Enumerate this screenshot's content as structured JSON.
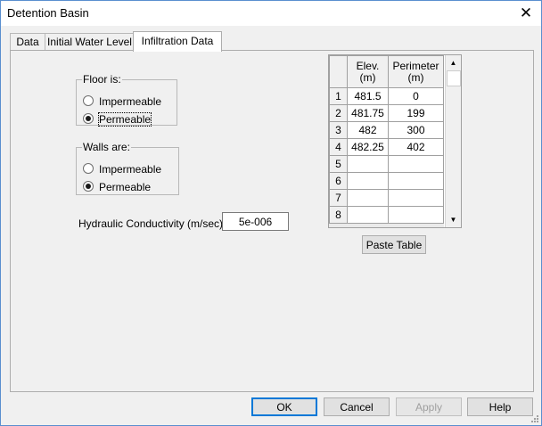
{
  "window": {
    "title": "Detention Basin"
  },
  "icons": {
    "close": "close-icon",
    "scroll_up": "scroll-up-arrow-icon",
    "scroll_down": "scroll-down-arrow-icon",
    "resize": "resize-grip-icon"
  },
  "tabs": [
    {
      "label": "Data"
    },
    {
      "label": "Initial Water Level"
    },
    {
      "label": "Infiltration Data"
    }
  ],
  "floor": {
    "legend": "Floor is:",
    "options": [
      {
        "label": "Impermeable",
        "checked": false
      },
      {
        "label": "Permeable",
        "checked": true
      }
    ]
  },
  "walls": {
    "legend": "Walls are:",
    "options": [
      {
        "label": "Impermeable",
        "checked": false
      },
      {
        "label": "Permeable",
        "checked": true
      }
    ]
  },
  "conductivity": {
    "label": "Hydraulic Conductivity (m/sec)",
    "value": "5e-006"
  },
  "table": {
    "headers": {
      "elev_line1": "Elev.",
      "elev_line2": "(m)",
      "perim_line1": "Perimeter",
      "perim_line2": "(m)"
    },
    "rows": [
      {
        "num": "1",
        "elev": "481.5",
        "perim": "0"
      },
      {
        "num": "2",
        "elev": "481.75",
        "perim": "199"
      },
      {
        "num": "3",
        "elev": "482",
        "perim": "300"
      },
      {
        "num": "4",
        "elev": "482.25",
        "perim": "402"
      },
      {
        "num": "5",
        "elev": "",
        "perim": ""
      },
      {
        "num": "6",
        "elev": "",
        "perim": ""
      },
      {
        "num": "7",
        "elev": "",
        "perim": ""
      },
      {
        "num": "8",
        "elev": "",
        "perim": ""
      }
    ]
  },
  "buttons": {
    "paste_table": "Paste Table",
    "ok": "OK",
    "cancel": "Cancel",
    "apply": "Apply",
    "help": "Help"
  }
}
